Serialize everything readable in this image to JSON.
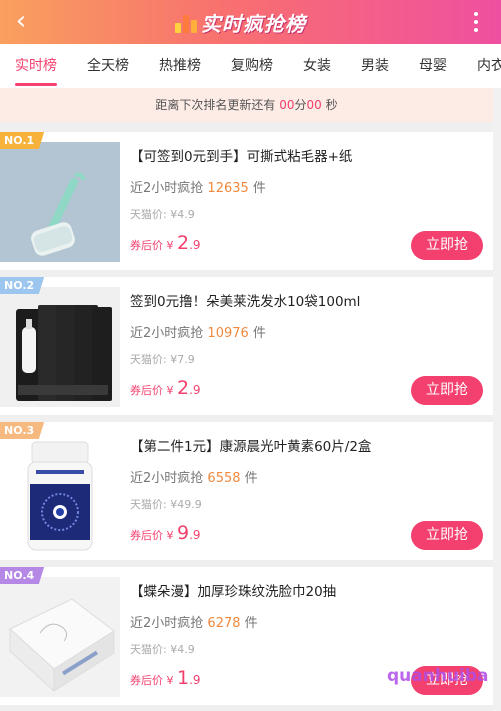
{
  "header": {
    "back_icon": "chevron-left-icon",
    "title": "实时疯抢榜",
    "more_icon": "more-vertical-icon"
  },
  "tabs": [
    "实时榜",
    "全天榜",
    "热推榜",
    "复购榜",
    "女装",
    "男装",
    "母婴",
    "内衣"
  ],
  "notice": {
    "prefix": "距离下次排名更新还有",
    "minutes": "00",
    "minutes_unit": "分",
    "seconds": "00",
    "seconds_unit": "秒"
  },
  "products": [
    {
      "rank": "NO.1",
      "title": "【可签到0元到手】可撕式粘毛器+纸",
      "sold_label": "近2小时疯抢",
      "sold_count": "12635",
      "sold_unit": "件",
      "orig_label": "天猫价: ¥4.9",
      "after_label": "券后价 ¥",
      "price_int": "2",
      "price_dec": ".9",
      "buy_label": "立即抢"
    },
    {
      "rank": "NO.2",
      "title": "签到0元撸！朵美莱洗发水10袋100ml",
      "sold_label": "近2小时疯抢",
      "sold_count": "10976",
      "sold_unit": "件",
      "orig_label": "天猫价: ¥7.9",
      "after_label": "券后价 ¥",
      "price_int": "2",
      "price_dec": ".9",
      "buy_label": "立即抢"
    },
    {
      "rank": "NO.3",
      "title": "【第二件1元】康源晨光叶黄素60片/2盒",
      "sold_label": "近2小时疯抢",
      "sold_count": "6558",
      "sold_unit": "件",
      "orig_label": "天猫价: ¥49.9",
      "after_label": "券后价 ¥",
      "price_int": "9",
      "price_dec": ".9",
      "buy_label": "立即抢"
    },
    {
      "rank": "NO.4",
      "title": "【蝶朵漫】加厚珍珠纹洗脸巾20抽",
      "sold_label": "近2小时疯抢",
      "sold_count": "6278",
      "sold_unit": "件",
      "orig_label": "天猫价: ¥4.9",
      "after_label": "券后价 ¥",
      "price_int": "1",
      "price_dec": ".9",
      "buy_label": "立即抢"
    }
  ],
  "watermark": "quanhuiba",
  "colors": {
    "accent": "#f3406e",
    "count": "#f0893e",
    "badge1": "#f7b23b",
    "badge2": "#9cc6ef",
    "badge3": "#f6b97f",
    "badge4": "#b588e6"
  }
}
